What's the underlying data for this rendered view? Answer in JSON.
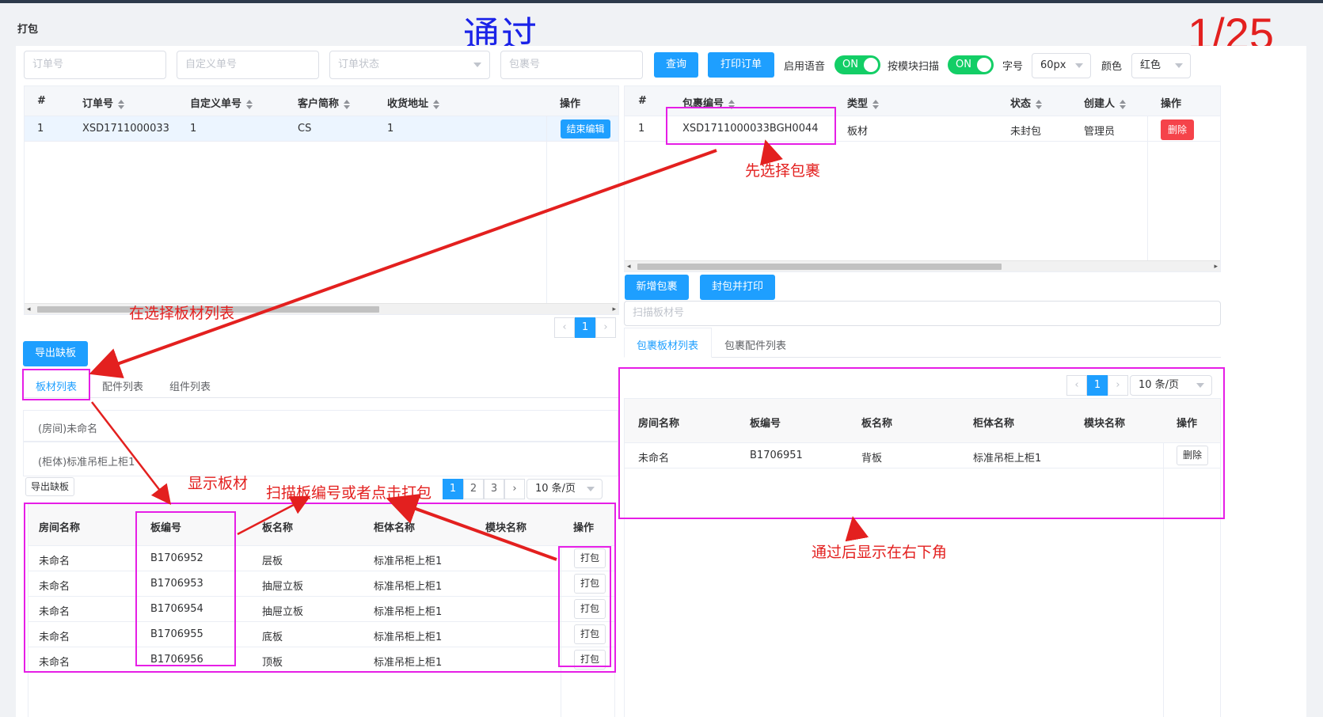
{
  "page": {
    "title": "打包"
  },
  "annotations": {
    "heading": "通过",
    "page_counter": "1/25",
    "select_package": "先选择包裹",
    "select_board_list": "在选择板材列表",
    "show_boards": "显示板材",
    "scan_or_click": "扫描板编号或者点击打包",
    "after_pass": "通过后显示在右下角"
  },
  "filters": {
    "order_no_placeholder": "订单号",
    "custom_no_placeholder": "自定义单号",
    "order_status_placeholder": "订单状态",
    "package_no_placeholder": "包裹号",
    "query_label": "查询",
    "print_order_label": "打印订单",
    "voice_label": "启用语音",
    "voice_state": "ON",
    "module_scan_label": "按模块扫描",
    "module_scan_state": "ON",
    "font_label": "字号",
    "font_value": "60px",
    "color_label": "颜色",
    "color_value": "红色"
  },
  "orders": {
    "headers": [
      "#",
      "订单号",
      "自定义单号",
      "客户简称",
      "收货地址",
      "操作"
    ],
    "rows": [
      {
        "idx": "1",
        "order_no": "XSD1711000033",
        "custom_no": "1",
        "customer": "CS",
        "address": "1",
        "action": "结束编辑"
      }
    ],
    "pager": {
      "current": "1"
    }
  },
  "packages": {
    "headers": [
      "#",
      "包裹编号",
      "类型",
      "状态",
      "创建人",
      "操作"
    ],
    "rows": [
      {
        "idx": "1",
        "package_no": "XSD1711000033BGH0044",
        "type": "板材",
        "status": "未封包",
        "creator": "管理员",
        "action": "删除"
      }
    ],
    "new_package_label": "新增包裹",
    "seal_print_label": "封包并打印",
    "scan_placeholder": "扫描板材号",
    "tabs": [
      "包裹板材列表",
      "包裹配件列表"
    ]
  },
  "export_label": "导出缺板",
  "lists": {
    "tabs": [
      "板材列表",
      "配件列表",
      "组件列表"
    ],
    "group_room": "(房间)未命名",
    "group_cabinet": "(柜体)标准吊柜上柜1",
    "export_small_label": "导出缺板",
    "pager": {
      "pages": [
        "1",
        "2",
        "3"
      ],
      "size": "10 条/页"
    }
  },
  "boards": {
    "headers": [
      "房间名称",
      "板编号",
      "板名称",
      "柜体名称",
      "模块名称",
      "操作"
    ],
    "rows": [
      {
        "room": "未命名",
        "board_no": "B1706952",
        "name": "层板",
        "cabinet": "标准吊柜上柜1",
        "module": "",
        "action": "打包"
      },
      {
        "room": "未命名",
        "board_no": "B1706953",
        "name": "抽屉立板",
        "cabinet": "标准吊柜上柜1",
        "module": "",
        "action": "打包"
      },
      {
        "room": "未命名",
        "board_no": "B1706954",
        "name": "抽屉立板",
        "cabinet": "标准吊柜上柜1",
        "module": "",
        "action": "打包"
      },
      {
        "room": "未命名",
        "board_no": "B1706955",
        "name": "底板",
        "cabinet": "标准吊柜上柜1",
        "module": "",
        "action": "打包"
      },
      {
        "room": "未命名",
        "board_no": "B1706956",
        "name": "顶板",
        "cabinet": "标准吊柜上柜1",
        "module": "",
        "action": "打包"
      }
    ]
  },
  "packed": {
    "headers": [
      "房间名称",
      "板编号",
      "板名称",
      "柜体名称",
      "模块名称",
      "操作"
    ],
    "rows": [
      {
        "room": "未命名",
        "board_no": "B1706951",
        "name": "背板",
        "cabinet": "标准吊柜上柜1",
        "module": "",
        "action": "删除"
      }
    ],
    "pager": {
      "current": "1",
      "size": "10 条/页"
    }
  }
}
